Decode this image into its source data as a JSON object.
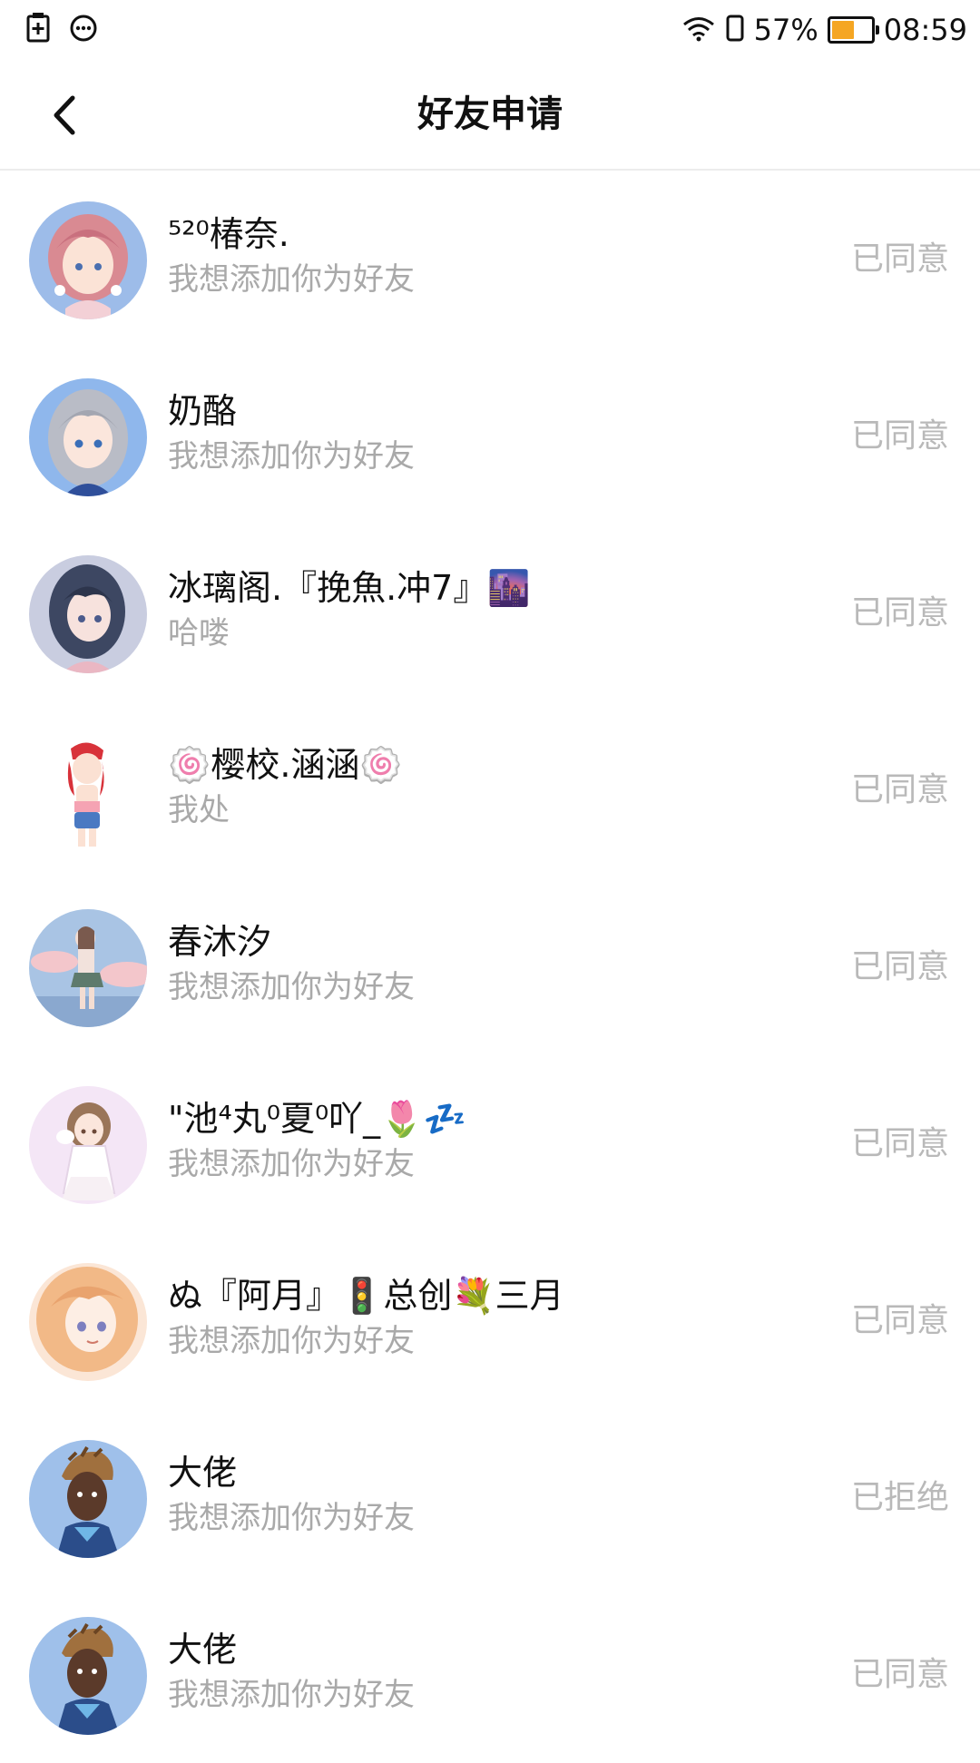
{
  "status_bar": {
    "icons_left": [
      "sim-card-icon",
      "message-bubble-icon"
    ],
    "icons_right": [
      "wifi-icon",
      "rotation-lock-icon"
    ],
    "battery_percent_label": "57%",
    "battery_level": 0.57,
    "battery_color": "#f5a623",
    "time": "08:59"
  },
  "header": {
    "back_icon": "chevron-left-icon",
    "title": "好友申请"
  },
  "requests": [
    {
      "name": "⁵²⁰椿奈.",
      "message": "我想添加你为好友",
      "status": "已同意"
    },
    {
      "name": "奶酪",
      "message": "我想添加你为好友",
      "status": "已同意"
    },
    {
      "name": "冰璃阁.『挽魚.冲7』🌆",
      "message": "哈喽",
      "status": "已同意"
    },
    {
      "name": "🍥樱校.涵涵🍥",
      "message": "我处",
      "status": "已同意"
    },
    {
      "name": "春沐汐",
      "message": "我想添加你为好友",
      "status": "已同意"
    },
    {
      "name": "\"池⁴丸⁰夏⁰吖_🌷💤",
      "message": "我想添加你为好友",
      "status": "已同意"
    },
    {
      "name": "ぬ『阿月』🚦总创💐三月",
      "message": "我想添加你为好友",
      "status": "已同意"
    },
    {
      "name": "大佬",
      "message": "我想添加你为好友",
      "status": "已拒绝"
    },
    {
      "name": "大佬",
      "message": "我想添加你为好友",
      "status": "已同意"
    }
  ],
  "colors": {
    "status_text": "#b9b9b9",
    "message_text": "#a9a9a9",
    "divider": "#ececec"
  }
}
